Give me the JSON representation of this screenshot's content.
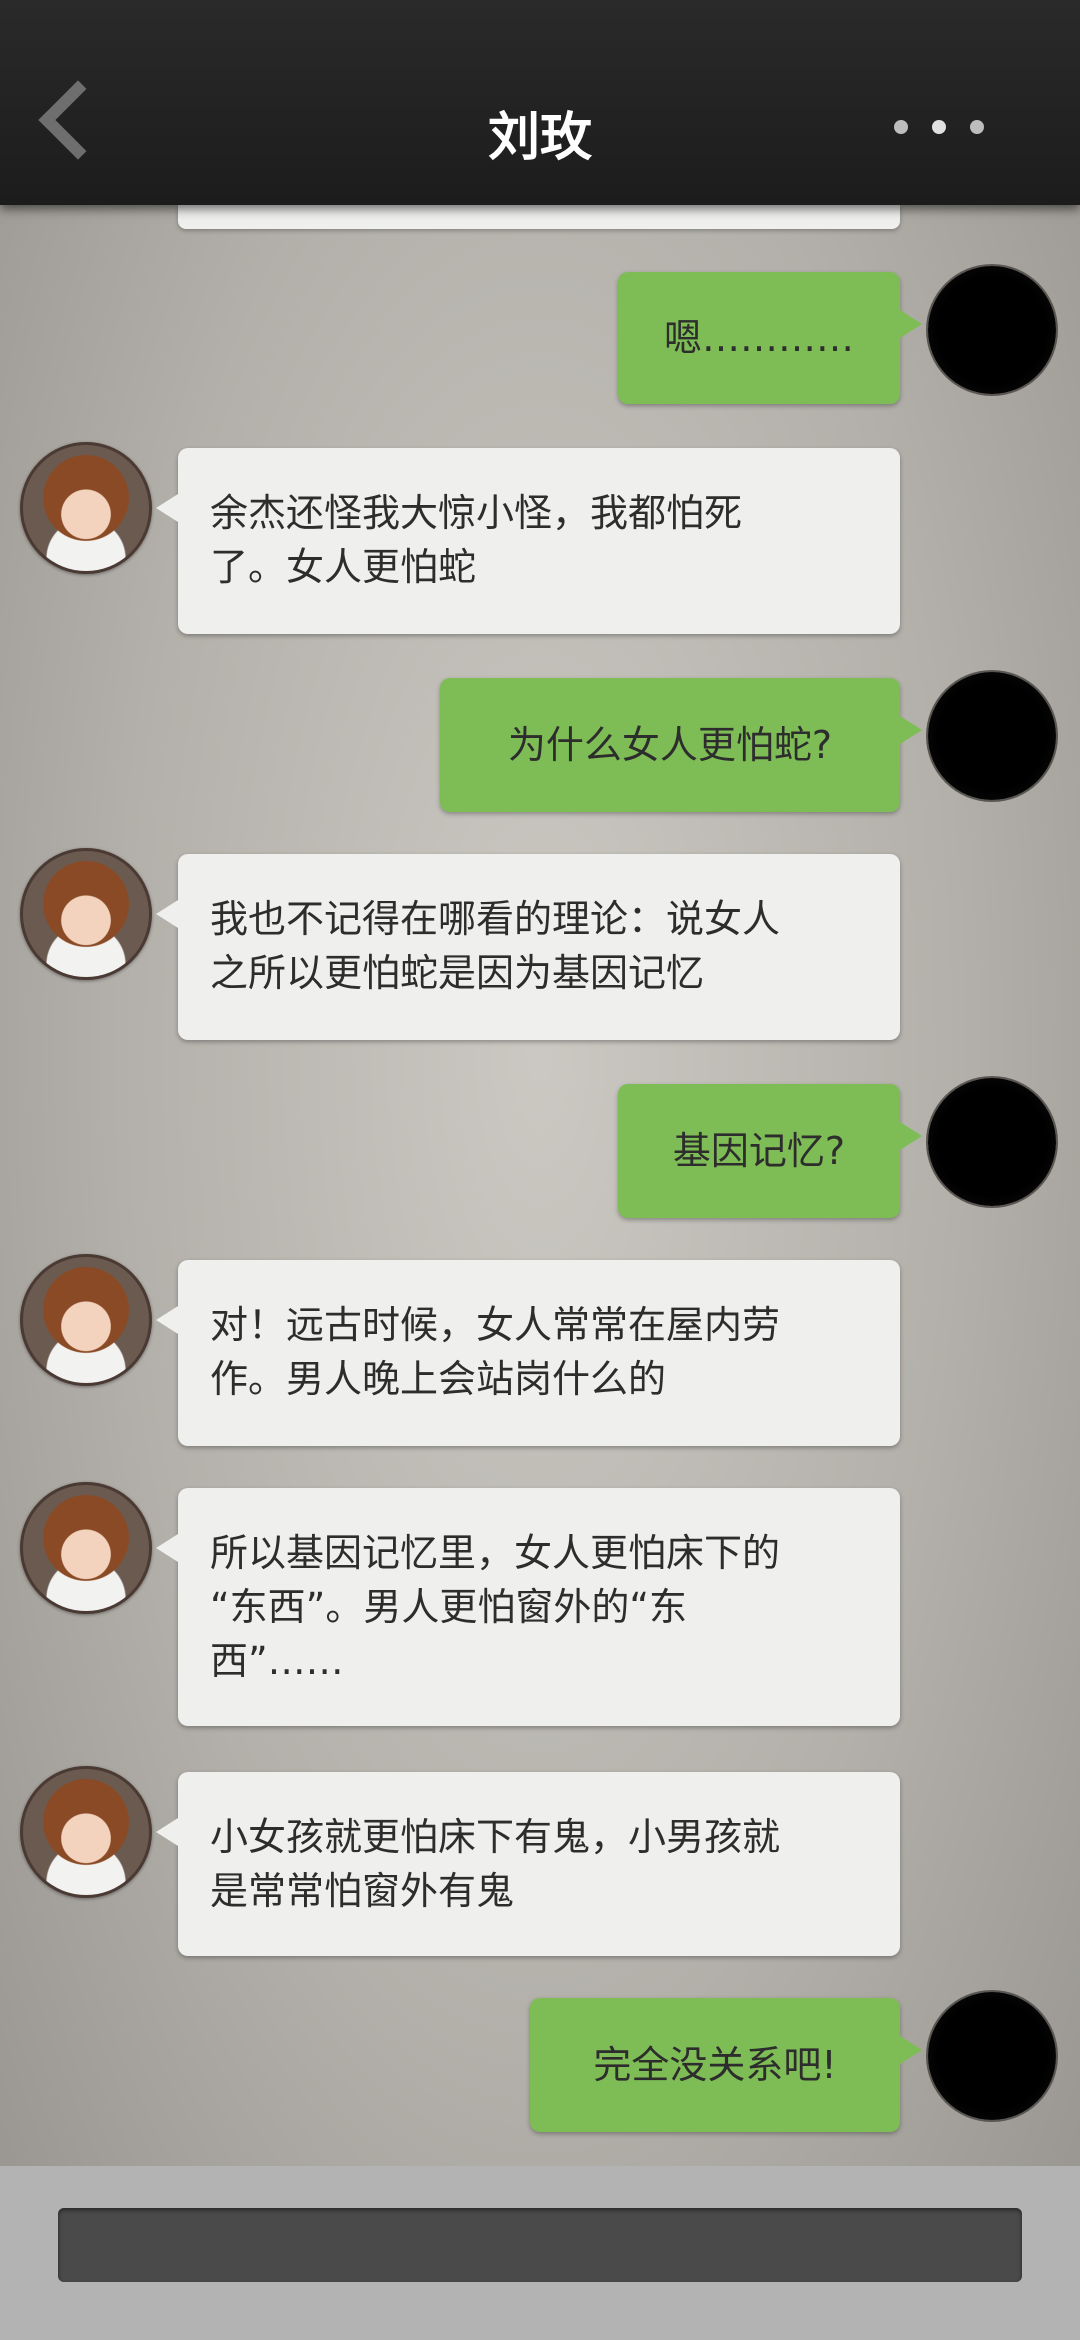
{
  "header": {
    "title": "刘玫",
    "back_icon": "chevron-left-icon",
    "more_icon": "more-horizontal-icon"
  },
  "messages": [
    {
      "side": "out",
      "text": "嗯…………"
    },
    {
      "side": "in",
      "lines": [
        "余杰还怪我大惊小怪，我都怕死",
        "了。女人更怕蛇"
      ]
    },
    {
      "side": "out",
      "text": "为什么女人更怕蛇?"
    },
    {
      "side": "in",
      "lines": [
        "我也不记得在哪看的理论：说女人",
        "之所以更怕蛇是因为基因记忆"
      ]
    },
    {
      "side": "out",
      "text": "基因记忆?"
    },
    {
      "side": "in",
      "lines": [
        "对！远古时候，女人常常在屋内劳",
        "作。男人晚上会站岗什么的"
      ]
    },
    {
      "side": "in",
      "lines": [
        "所以基因记忆里，女人更怕床下的",
        "“东西”。男人更怕窗外的“东",
        "西”……"
      ]
    },
    {
      "side": "in",
      "lines": [
        "小女孩就更怕床下有鬼，小男孩就",
        "是常常怕窗外有鬼"
      ]
    },
    {
      "side": "out",
      "text": "完全没关系吧!"
    }
  ],
  "input": {
    "value": ""
  }
}
